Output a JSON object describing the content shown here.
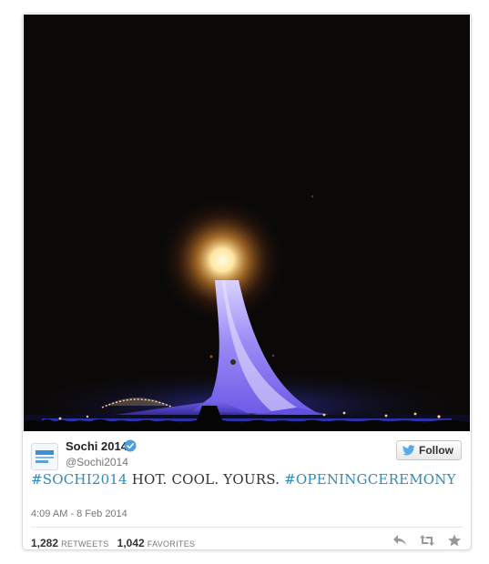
{
  "tweet": {
    "display_name": "Sochi 2014",
    "handle": "@Sochi2014",
    "follow_label": "Follow",
    "text": {
      "hashtag1": "#SOCHI2014",
      "middle": " HOT. COOL. YOURS. ",
      "hashtag2": "#OPENINGCEREMONY"
    },
    "timestamp": "4:09 AM - 8 Feb 2014",
    "retweets_count": "1,282",
    "retweets_label": "RETWEETS",
    "favorites_count": "1,042",
    "favorites_label": "FAVORITES"
  },
  "icons": {
    "verified": "verified-badge-icon",
    "follow_bird": "twitter-bird-icon",
    "reply": "reply-icon",
    "retweet": "retweet-icon",
    "favorite": "star-icon"
  },
  "colors": {
    "hashtag": "#2f8aba",
    "verified": "#4a9fe3",
    "flame": "#ffd27a",
    "tower": "#8a7bf0"
  }
}
